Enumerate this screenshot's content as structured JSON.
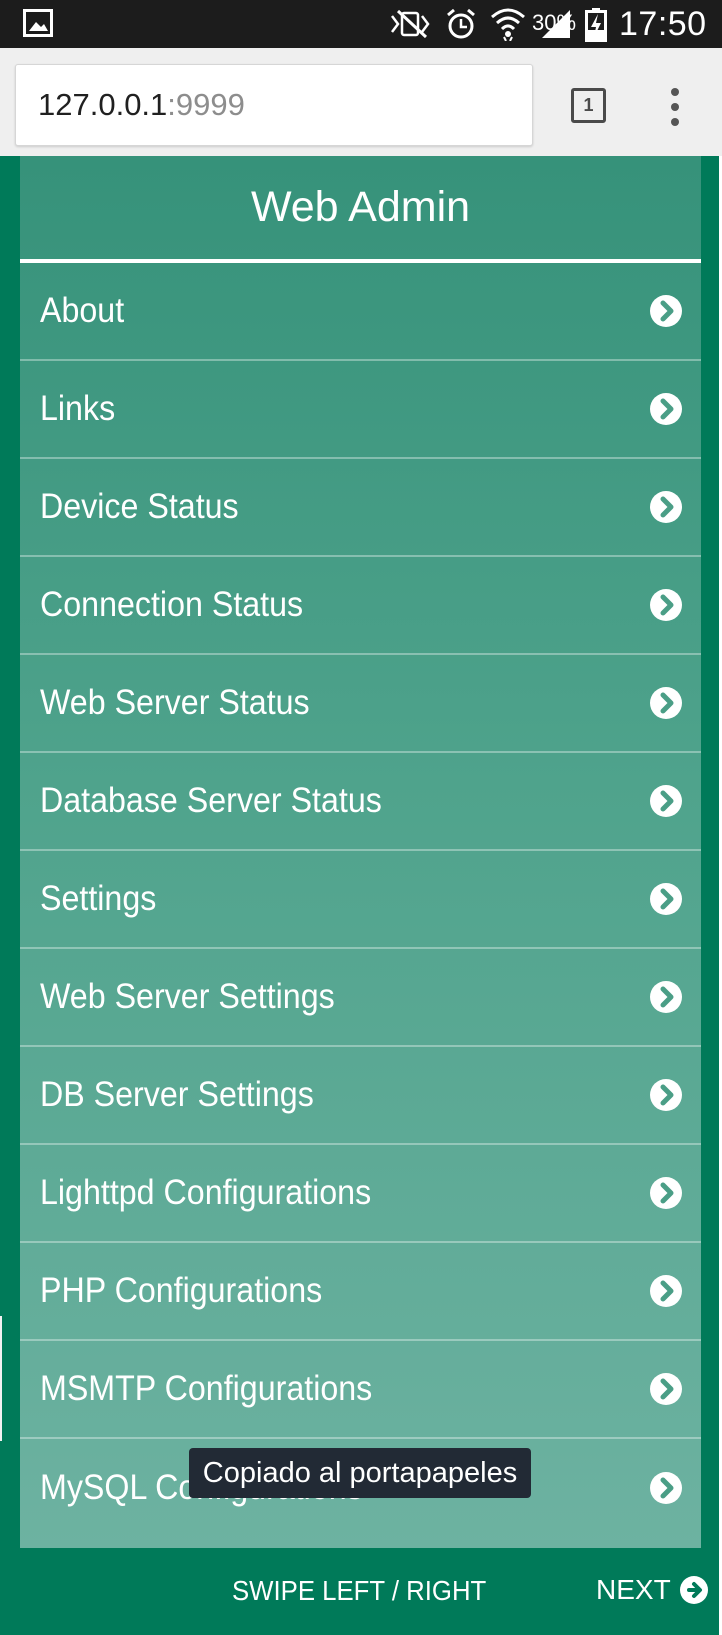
{
  "status_bar": {
    "battery_percent": "30%",
    "time": "17:50",
    "icons": [
      "gallery-icon",
      "bluetooth-vibrate-icon",
      "alarm-icon",
      "wifi-icon",
      "signal-icon",
      "battery-charging-icon"
    ]
  },
  "browser": {
    "url_host": "127.0.0.1",
    "url_port": ":9999",
    "tab_count": "1"
  },
  "panel": {
    "title": "Web Admin",
    "items": [
      {
        "label": "About"
      },
      {
        "label": "Links"
      },
      {
        "label": "Device Status"
      },
      {
        "label": "Connection Status"
      },
      {
        "label": "Web Server Status"
      },
      {
        "label": "Database Server Status"
      },
      {
        "label": "Settings"
      },
      {
        "label": "Web Server Settings"
      },
      {
        "label": "DB Server Settings"
      },
      {
        "label": "Lighttpd Configurations"
      },
      {
        "label": "PHP Configurations"
      },
      {
        "label": "MSMTP Configurations"
      },
      {
        "label": "MySQL Configurations"
      }
    ]
  },
  "footer": {
    "swipe_hint": "SWIPE LEFT / RIGHT",
    "next_label": "NEXT"
  },
  "toast": {
    "message": "Copiado al portapapeles"
  },
  "colors": {
    "page_background": "#007a59",
    "panel_top": "#36927a",
    "panel_bottom": "#6db2a1",
    "status_bar": "#1c1c1c",
    "toolbar": "#efefef",
    "toast": "#222a35"
  }
}
